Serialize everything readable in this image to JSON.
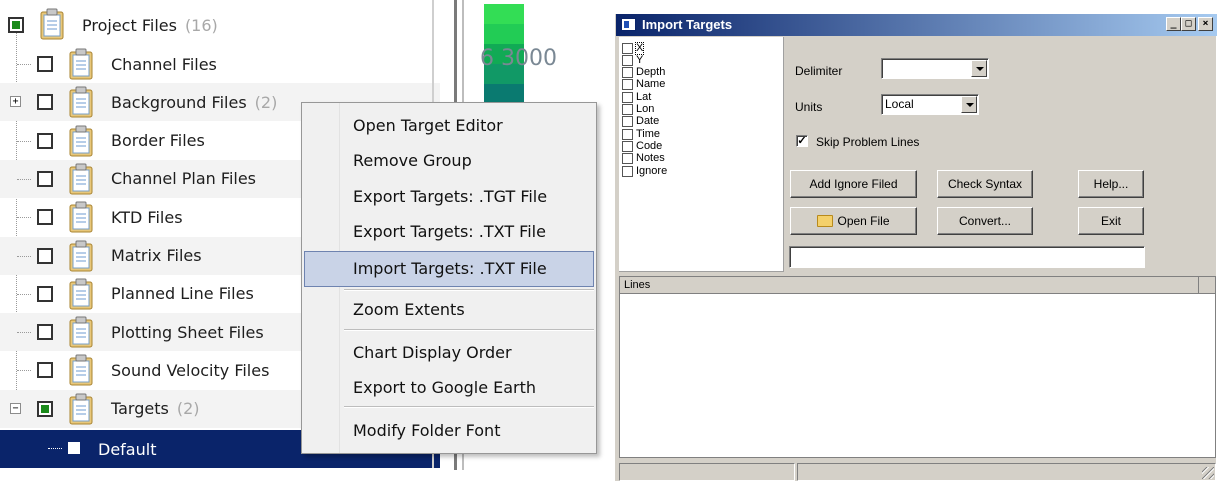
{
  "tree": {
    "root": {
      "label": "Project Files",
      "count": "(16)"
    },
    "items": [
      {
        "label": "Channel Files",
        "count": ""
      },
      {
        "label": "Background Files",
        "count": "(2)"
      },
      {
        "label": "Border Files",
        "count": ""
      },
      {
        "label": "Channel Plan Files",
        "count": ""
      },
      {
        "label": "KTD Files",
        "count": ""
      },
      {
        "label": "Matrix Files",
        "count": ""
      },
      {
        "label": "Planned Line Files",
        "count": ""
      },
      {
        "label": "Plotting Sheet Files",
        "count": ""
      },
      {
        "label": "Sound Velocity Files",
        "count": ""
      },
      {
        "label": "Targets",
        "count": "(2)"
      }
    ],
    "selected_child": {
      "label": "Default"
    }
  },
  "map_scale_text": "6 3000",
  "scale_colors": [
    "#33dd55",
    "#22cc55",
    "#11aa55",
    "#119966",
    "#0a7a70",
    "#0a5a80"
  ],
  "context_menu": {
    "items": [
      "Open Target Editor",
      "Remove Group",
      "Export Targets: .TGT File",
      "Export Targets: .TXT File",
      "Import Targets: .TXT File",
      "Zoom Extents",
      "Chart Display Order",
      "Export to Google Earth",
      "Modify Folder Font"
    ],
    "highlighted": "Import Targets: .TXT File"
  },
  "dialog": {
    "title": "Import Targets",
    "titlebar_buttons": {
      "minimize": "_",
      "maximize": "□",
      "close": "×"
    },
    "fields": [
      "X",
      "Y",
      "Depth",
      "Name",
      "Lat",
      "Lon",
      "Date",
      "Time",
      "Code",
      "Notes",
      "Ignore"
    ],
    "delimiter_label": "Delimiter",
    "delimiter_value": "",
    "units_label": "Units",
    "units_value": "Local",
    "skip_problem_lines_label": "Skip Problem Lines",
    "skip_problem_lines_checked": "✓",
    "buttons": {
      "add_ignore": "Add Ignore Filed",
      "check_syntax": "Check Syntax",
      "help": "Help...",
      "open_file": "Open File",
      "convert": "Convert...",
      "exit": "Exit"
    },
    "path_value": "",
    "lines_header": "Lines",
    "colors": {
      "title_start": "#0a246a",
      "title_end": "#a6caf0",
      "face": "#d4d0c8"
    }
  }
}
